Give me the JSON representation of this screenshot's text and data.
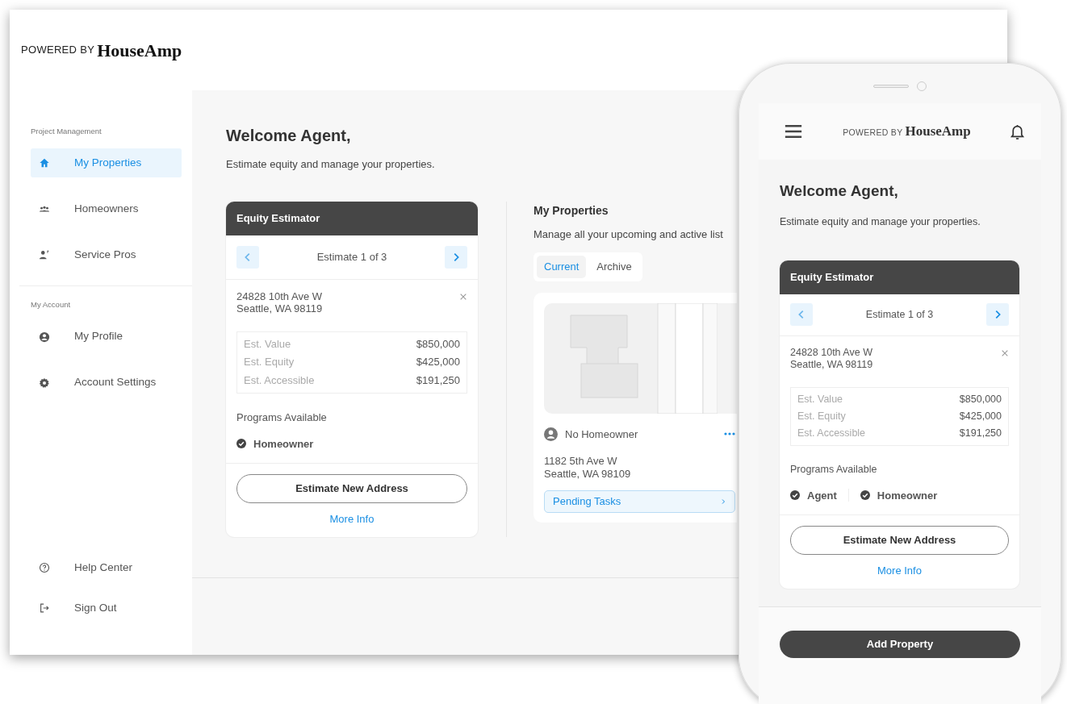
{
  "desktop": {
    "logo": {
      "prefix": "POWERED BY",
      "brand": "HouseAmp"
    },
    "sidebar": {
      "sections": [
        {
          "heading": "Project Management",
          "items": [
            {
              "label": "My Properties",
              "selected": true
            },
            {
              "label": "Homeowners",
              "selected": false
            },
            {
              "label": "Service Pros",
              "selected": false
            }
          ]
        },
        {
          "heading": "My Account",
          "items": [
            {
              "label": "My Profile",
              "selected": false
            },
            {
              "label": "Account Settings",
              "selected": false
            }
          ]
        }
      ],
      "footer_items": [
        {
          "label": "Help Center"
        },
        {
          "label": "Sign Out"
        }
      ]
    },
    "welcome": {
      "title": "Welcome Agent,",
      "subtitle": "Estimate equity and manage your properties."
    },
    "estimator": {
      "title": "Equity Estimator",
      "pager": "Estimate 1 of 3",
      "address": [
        "24828 10th Ave W",
        "Seattle, WA 98119"
      ],
      "estimates": [
        {
          "label": "Est. Value",
          "value": "$850,000"
        },
        {
          "label": "Est. Equity",
          "value": "$425,000"
        },
        {
          "label": "Est. Accessible",
          "value": "$191,250"
        }
      ],
      "programs_heading": "Programs Available",
      "programs": [
        "Homeowner"
      ],
      "button": "Estimate New Address",
      "link": "More Info"
    },
    "properties": {
      "title": "My Properties",
      "subtitle": "Manage all your upcoming and active list",
      "tabs": [
        {
          "label": "Current",
          "selected": true
        },
        {
          "label": "Archive",
          "selected": false
        }
      ],
      "card": {
        "owner": "No Homeowner",
        "address": [
          "1182 5th Ave W",
          "Seattle, WA 98109"
        ],
        "action": "Pending Tasks"
      }
    }
  },
  "phone": {
    "logo": {
      "prefix": "POWERED BY",
      "brand": "HouseAmp"
    },
    "welcome": {
      "title": "Welcome Agent,",
      "subtitle": "Estimate equity and manage your properties."
    },
    "estimator": {
      "title": "Equity Estimator",
      "pager": "Estimate 1 of 3",
      "address": [
        "24828 10th Ave W",
        "Seattle, WA 98119"
      ],
      "estimates": [
        {
          "label": "Est. Value",
          "value": "$850,000"
        },
        {
          "label": "Est. Equity",
          "value": "$425,000"
        },
        {
          "label": "Est. Accessible",
          "value": "$191,250"
        }
      ],
      "programs_heading": "Programs Available",
      "programs": [
        "Agent",
        "Homeowner"
      ],
      "button": "Estimate New Address",
      "link": "More Info"
    },
    "button": "Add Property"
  }
}
